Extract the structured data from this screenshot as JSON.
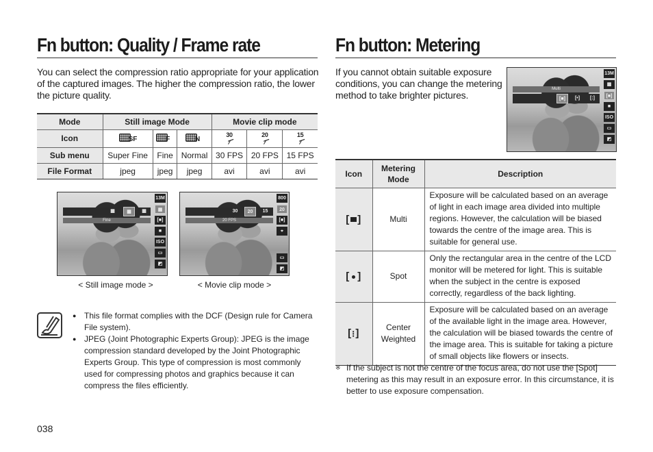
{
  "left": {
    "title": "Fn button: Quality / Frame rate",
    "intro": "You can select the compression ratio appropriate for your application of the captured images. The higher the compression ratio, the lower the picture quality.",
    "table": {
      "headers": {
        "mode": "Mode",
        "still": "Still image Mode",
        "movie": "Movie clip mode"
      },
      "row_labels": {
        "icon": "Icon",
        "sub_menu": "Sub menu",
        "file_format": "File Format"
      },
      "columns": [
        {
          "icon": "quality-super-fine-icon",
          "icon_sub": "SF",
          "sub_menu": "Super Fine",
          "file_format": "jpeg"
        },
        {
          "icon": "quality-fine-icon",
          "icon_sub": "F",
          "sub_menu": "Fine",
          "file_format": "jpeg"
        },
        {
          "icon": "quality-normal-icon",
          "icon_sub": "N",
          "sub_menu": "Normal",
          "file_format": "jpeg"
        },
        {
          "icon": "fps-30-icon",
          "icon_num": "30",
          "sub_menu": "30 FPS",
          "file_format": "avi"
        },
        {
          "icon": "fps-20-icon",
          "icon_num": "20",
          "sub_menu": "20 FPS",
          "file_format": "avi"
        },
        {
          "icon": "fps-15-icon",
          "icon_num": "15",
          "sub_menu": "15 FPS",
          "file_format": "avi"
        }
      ]
    },
    "screens": {
      "still": {
        "label": "Fine",
        "caption": "< Still image mode >",
        "top_icon": "13M"
      },
      "movie": {
        "label": "20 FPS",
        "caption": "< Movie clip mode >",
        "top_icon": "800",
        "options": [
          "30",
          "20",
          "15"
        ]
      }
    },
    "notes": [
      "This file format complies with the DCF (Design rule for Camera File system).",
      "JPEG (Joint Photographic Experts Group): JPEG is the image compression standard developed by the Joint Photographic Experts Group. This type of compression is most commonly used for compressing photos and graphics because it can compress the files efficiently."
    ],
    "page_number": "038"
  },
  "right": {
    "title": "Fn button: Metering",
    "intro": "If you cannot obtain suitable exposure conditions, you can change the metering method to take brighter pictures.",
    "screen": {
      "label": "Multi",
      "top_icon": "13M"
    },
    "table": {
      "headers": {
        "icon": "Icon",
        "mode": "Metering Mode",
        "description": "Description"
      },
      "rows": [
        {
          "icon": "multi-metering-icon",
          "mode": "Multi",
          "description": "Exposure will be calculated based on an average of light in each image area divided into multiple regions. However, the calculation will be biased towards the centre of the image area. This is suitable for general use."
        },
        {
          "icon": "spot-metering-icon",
          "mode": "Spot",
          "description": "Only the rectangular area in the centre of the LCD monitor will be metered for light. This is suitable when the subject in the centre is exposed correctly, regardless of the back lighting."
        },
        {
          "icon": "center-weighted-metering-icon",
          "mode": "Center Weighted",
          "description": "Exposure will be calculated based on an average of the available light in the image area. However, the calculation will be biased towards the centre of the image area. This is suitable for taking a picture of small objects like flowers or insects."
        }
      ]
    },
    "footnote_mark": "※",
    "footnote": "If the subject is not the centre of the focus area, do not use the [Spot] metering as this may result in an exposure error. In this circumstance, it is better to use exposure compensation."
  }
}
